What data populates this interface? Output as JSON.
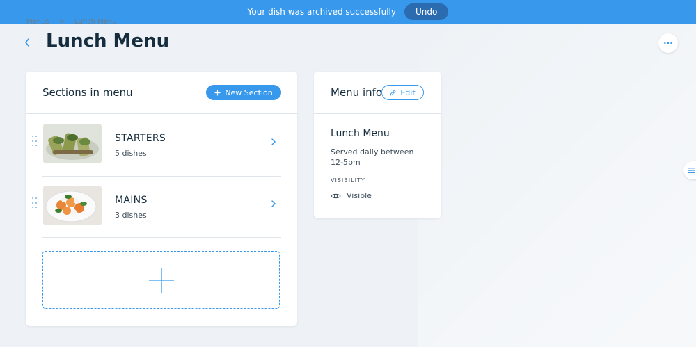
{
  "toast": {
    "message": "Your dish was archived successfully",
    "undo_label": "Undo"
  },
  "breadcrumb": {
    "root": "Menus",
    "separator": ">",
    "current": "Lunch Menu"
  },
  "header": {
    "title": "Lunch Menu",
    "more_label": "···"
  },
  "sections_card": {
    "title": "Sections in menu",
    "new_section_label": "New Section",
    "sections": [
      {
        "name": "STARTERS",
        "count": "5 dishes"
      },
      {
        "name": "MAINS",
        "count": "3 dishes"
      }
    ]
  },
  "info_card": {
    "title": "Menu info",
    "edit_label": "Edit",
    "menu_name": "Lunch Menu",
    "description": "Served daily between 12-5pm",
    "visibility_label": "VISIBILITY",
    "visibility_value": "Visible"
  },
  "colors": {
    "accent": "#3899ec",
    "toast_bg": "#3899ec",
    "page_bg": "#eef2f6"
  }
}
